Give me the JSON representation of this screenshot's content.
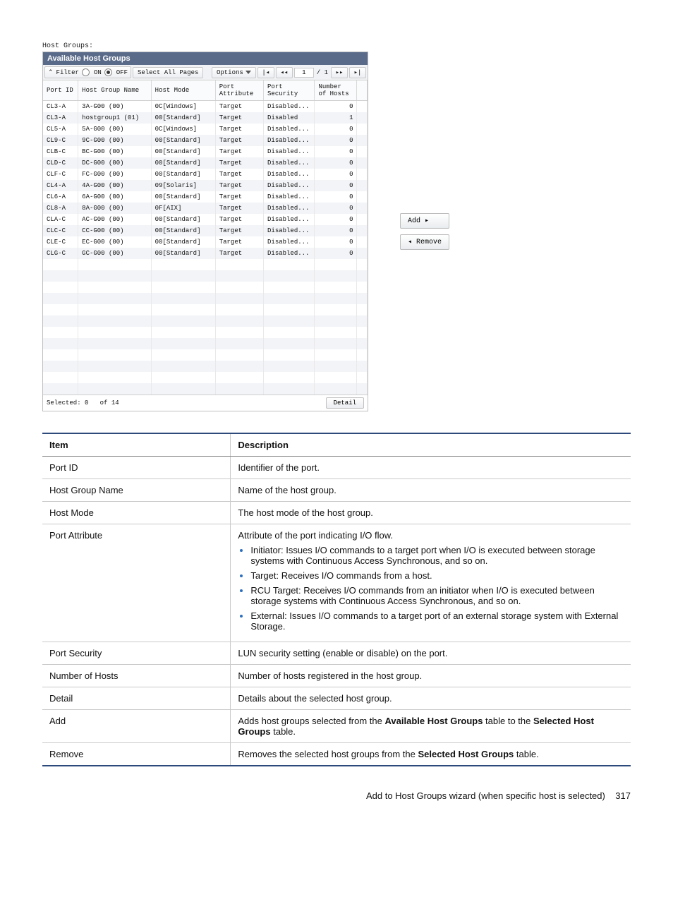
{
  "section_label": "Host Groups:",
  "panel_title": "Available Host Groups",
  "toolbar": {
    "filter_label": "Filter",
    "on_label": "ON",
    "off_label": "OFF",
    "select_all_label": "Select All Pages",
    "options_label": "Options",
    "page_current": "1",
    "page_total": "/ 1"
  },
  "columns": {
    "port_id": "Port ID",
    "host_group_name": "Host Group Name",
    "host_mode": "Host Mode",
    "port_attribute": "Port\nAttribute",
    "port_security": "Port\nSecurity",
    "number_of_hosts": "Number\nof Hosts"
  },
  "rows": [
    {
      "port_id": "CL3-A",
      "hgn": "3A-G00 (00)",
      "mode": "0C[Windows]",
      "attr": "Target",
      "sec": "Disabled...",
      "n": "0"
    },
    {
      "port_id": "CL3-A",
      "hgn": "hostgroup1 (01)",
      "mode": "00[Standard]",
      "attr": "Target",
      "sec": "Disabled",
      "n": "1"
    },
    {
      "port_id": "CL5-A",
      "hgn": "5A-G00 (00)",
      "mode": "0C[Windows]",
      "attr": "Target",
      "sec": "Disabled...",
      "n": "0"
    },
    {
      "port_id": "CL9-C",
      "hgn": "9C-G00 (00)",
      "mode": "00[Standard]",
      "attr": "Target",
      "sec": "Disabled...",
      "n": "0"
    },
    {
      "port_id": "CLB-C",
      "hgn": "BC-G00 (00)",
      "mode": "00[Standard]",
      "attr": "Target",
      "sec": "Disabled...",
      "n": "0"
    },
    {
      "port_id": "CLD-C",
      "hgn": "DC-G00 (00)",
      "mode": "00[Standard]",
      "attr": "Target",
      "sec": "Disabled...",
      "n": "0"
    },
    {
      "port_id": "CLF-C",
      "hgn": "FC-G00 (00)",
      "mode": "00[Standard]",
      "attr": "Target",
      "sec": "Disabled...",
      "n": "0"
    },
    {
      "port_id": "CL4-A",
      "hgn": "4A-G00 (00)",
      "mode": "09[Solaris]",
      "attr": "Target",
      "sec": "Disabled...",
      "n": "0"
    },
    {
      "port_id": "CL6-A",
      "hgn": "6A-G00 (00)",
      "mode": "00[Standard]",
      "attr": "Target",
      "sec": "Disabled...",
      "n": "0"
    },
    {
      "port_id": "CL8-A",
      "hgn": "8A-G00 (00)",
      "mode": "0F[AIX]",
      "attr": "Target",
      "sec": "Disabled...",
      "n": "0"
    },
    {
      "port_id": "CLA-C",
      "hgn": "AC-G00 (00)",
      "mode": "00[Standard]",
      "attr": "Target",
      "sec": "Disabled...",
      "n": "0"
    },
    {
      "port_id": "CLC-C",
      "hgn": "CC-G00 (00)",
      "mode": "00[Standard]",
      "attr": "Target",
      "sec": "Disabled...",
      "n": "0"
    },
    {
      "port_id": "CLE-C",
      "hgn": "EC-G00 (00)",
      "mode": "00[Standard]",
      "attr": "Target",
      "sec": "Disabled...",
      "n": "0"
    },
    {
      "port_id": "CLG-C",
      "hgn": "GC-G00 (00)",
      "mode": "00[Standard]",
      "attr": "Target",
      "sec": "Disabled...",
      "n": "0"
    }
  ],
  "empty_row_count": 12,
  "status": {
    "selected_label": "Selected:",
    "selected_count": "0",
    "of_label": "of",
    "total": "14",
    "detail_label": "Detail"
  },
  "side": {
    "add_label": "Add ▸",
    "remove_label": "◂ Remove"
  },
  "desc": {
    "headers": {
      "item": "Item",
      "description": "Description"
    },
    "rows": [
      {
        "item": "Port ID",
        "desc_html": "Identifier of the port."
      },
      {
        "item": "Host Group Name",
        "desc_html": "Name of the host group."
      },
      {
        "item": "Host Mode",
        "desc_html": "The host mode of the host group."
      },
      {
        "item": "Port Attribute",
        "desc_html": "Attribute of the port indicating I/O flow.<ul><li>Initiator: Issues I/O commands to a target port when I/O is executed between storage systems with Continuous Access Synchronous, and so on.</li><li>Target: Receives I/O commands from a host.</li><li>RCU Target: Receives I/O commands from an initiator when I/O is executed between storage systems with Continuous Access Synchronous, and so on.</li><li>External: Issues I/O commands to a target port of an external storage system with External Storage.</li></ul>"
      },
      {
        "item": "Port Security",
        "desc_html": "LUN security setting (enable or disable) on the port."
      },
      {
        "item": "Number of Hosts",
        "desc_html": "Number of hosts registered in the host group."
      },
      {
        "item": "Detail",
        "desc_html": "Details about the selected host group."
      },
      {
        "item": "Add",
        "desc_html": "Adds host groups selected from the <b>Available Host Groups</b> table to the <b>Selected Host Groups</b> table."
      },
      {
        "item": "Remove",
        "desc_html": "Removes the selected host groups from the <b>Selected Host Groups</b> table."
      }
    ]
  },
  "footer": {
    "text": "Add to Host Groups wizard (when specific host is selected)",
    "page_number": "317"
  }
}
